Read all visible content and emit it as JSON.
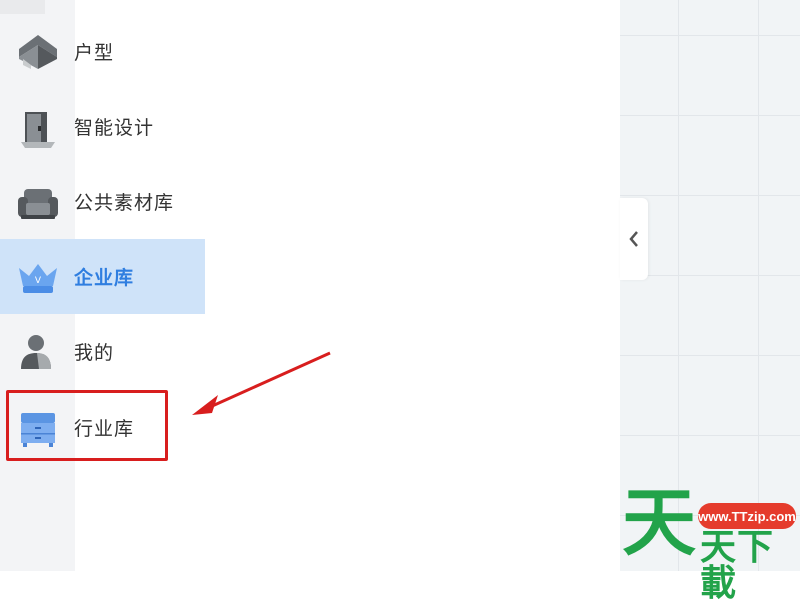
{
  "sidebar": {
    "items": [
      {
        "label": "户型",
        "icon": "floorplan-icon"
      },
      {
        "label": "智能设计",
        "icon": "door-icon"
      },
      {
        "label": "公共素材库",
        "icon": "sofa-icon"
      },
      {
        "label": "企业库",
        "icon": "crown-icon",
        "active": true
      },
      {
        "label": "我的",
        "icon": "user-icon"
      },
      {
        "label": "行业库",
        "icon": "cabinet-icon",
        "highlighted": true
      }
    ]
  },
  "canvas": {
    "collapse_icon": "chevron-left-icon"
  },
  "annotation": {
    "color": "#d81e1e"
  },
  "watermark": {
    "url": "www.TTzip.com",
    "big_char": "天",
    "text": "天下載"
  },
  "colors": {
    "active_bg": "#cfe3f9",
    "active_text": "#2f7ee0",
    "canvas_bg": "#f1f4f6",
    "watermark_green": "#22a34a",
    "watermark_red": "#e53b2c"
  }
}
